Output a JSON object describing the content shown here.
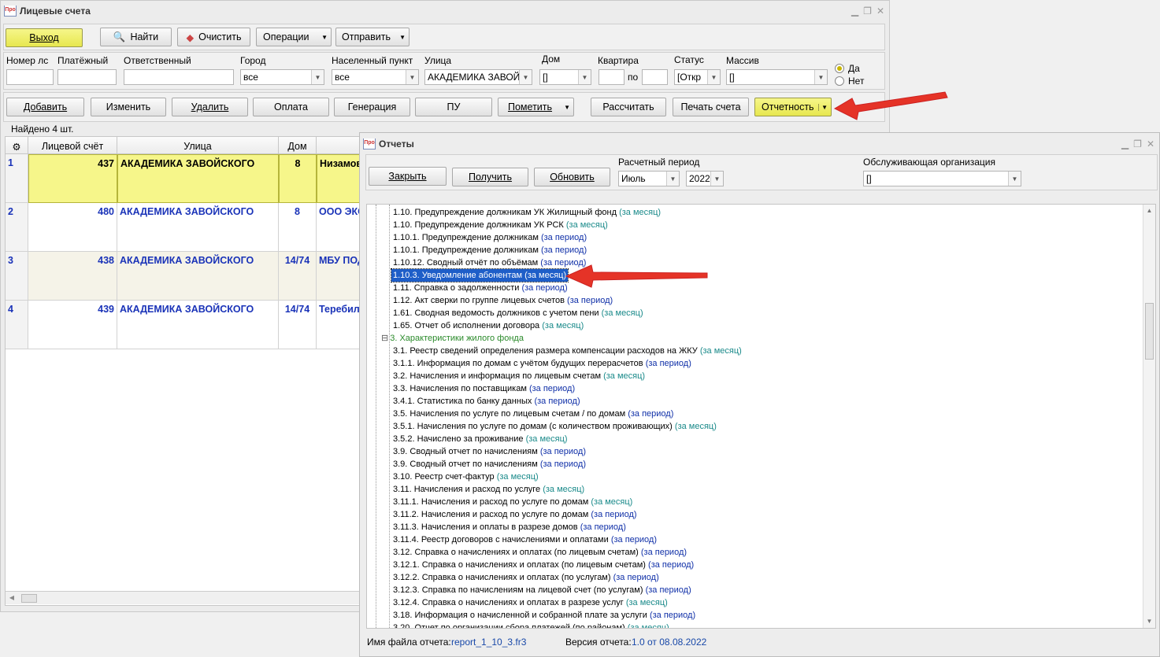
{
  "main": {
    "title": "Лицевые счета",
    "toolbar": {
      "exit": "Выход",
      "find": "Найти",
      "clear": "Очистить",
      "operations": "Операции",
      "send": "Отправить"
    },
    "filters": {
      "account_label": "Номер лс",
      "payer_label": "Платёжный",
      "responsible_label": "Ответственный",
      "city_label": "Город",
      "city_value": "все",
      "locality_label": "Населенный пункт",
      "locality_value": "все",
      "street_label": "Улица",
      "street_value": "АКАДЕМИКА ЗАВОЙСКОГО",
      "house_label": "Дом",
      "house_value": "[]",
      "apartment_label": "Квартира",
      "apartment_to": "по",
      "status_label": "Статус",
      "status_value": "[Откр",
      "array_label": "Массив",
      "array_value": "[]",
      "yes": "Да",
      "no": "Нет"
    },
    "actions": {
      "add": "Добавить",
      "edit": "Изменить",
      "delete": "Удалить",
      "payment": "Оплата",
      "generation": "Генерация",
      "pu": "ПУ",
      "mark": "Пометить",
      "calculate": "Рассчитать",
      "print": "Печать счета",
      "reports": "Отчетность"
    },
    "found": "Найдено 4 шт.",
    "columns": {
      "account": "Лицевой счёт",
      "street": "Улица",
      "house": "Дом"
    },
    "rows": [
      {
        "n": "1",
        "account": "437",
        "street": "АКАДЕМИКА ЗАВОЙСКОГО",
        "house": "8",
        "extra": "Низамов"
      },
      {
        "n": "2",
        "account": "480",
        "street": "АКАДЕМИКА ЗАВОЙСКОГО",
        "house": "8",
        "extra": "ООО ЭКО"
      },
      {
        "n": "3",
        "account": "438",
        "street": "АКАДЕМИКА ЗАВОЙСКОГО",
        "house": "14/74",
        "extra": "МБУ ПОД"
      },
      {
        "n": "4",
        "account": "439",
        "street": "АКАДЕМИКА ЗАВОЙСКОГО",
        "house": "14/74",
        "extra": "Теребил"
      }
    ]
  },
  "reports": {
    "title": "Отчеты",
    "close": "Закрыть",
    "get": "Получить",
    "refresh": "Обновить",
    "period_label": "Расчетный период",
    "month": "Июль",
    "year": "2022",
    "org_label": "Обслуживающая организация",
    "org_value": "[]",
    "tree": [
      {
        "t": "1.10. Предупреждение должникам УК Жилищный фонд",
        "p": "(за месяц)",
        "k": "mon"
      },
      {
        "t": "1.10. Предупреждение должникам УК РСК",
        "p": "(за месяц)",
        "k": "mon"
      },
      {
        "t": "1.10.1. Предупреждение должникам",
        "p": "(за период)",
        "k": "per"
      },
      {
        "t": "1.10.1. Предупреждение должникам",
        "p": "(за период)",
        "k": "per"
      },
      {
        "t": "1.10.12. Сводный отчёт по объёмам",
        "p": "(за период)",
        "k": "per"
      },
      {
        "t": "1.10.3. Уведомление абонентам",
        "p": "(за месяц)",
        "k": "mon",
        "sel": true
      },
      {
        "t": "1.11. Справка о задолженности",
        "p": "(за период)",
        "k": "per"
      },
      {
        "t": "1.12. Акт сверки по группе лицевых счетов",
        "p": "(за период)",
        "k": "per"
      },
      {
        "t": "1.61. Сводная ведомость должников с учетом пени",
        "p": "(за месяц)",
        "k": "mon"
      },
      {
        "t": "1.65. Отчет об исполнении договора",
        "p": "(за месяц)",
        "k": "mon"
      },
      {
        "t": "3. Характеристики жилого фонда",
        "p": "",
        "k": "grp"
      },
      {
        "t": "3.1. Реестр сведений определения размера компенсации расходов на ЖКУ",
        "p": "(за месяц)",
        "k": "mon"
      },
      {
        "t": "3.1.1. Информация по домам с учётом будущих перерасчетов",
        "p": "(за период)",
        "k": "per"
      },
      {
        "t": "3.2. Начисления и информация по лицевым счетам",
        "p": "(за месяц)",
        "k": "mon"
      },
      {
        "t": "3.3. Начисления по поставщикам",
        "p": "(за период)",
        "k": "per"
      },
      {
        "t": "3.4.1. Статистика по банку данных",
        "p": "(за период)",
        "k": "per"
      },
      {
        "t": "3.5. Начисления по услуге по лицевым счетам / по домам",
        "p": "(за период)",
        "k": "per"
      },
      {
        "t": "3.5.1. Начисления по услуге по домам (с количеством проживающих)",
        "p": "(за месяц)",
        "k": "mon"
      },
      {
        "t": "3.5.2. Начислено за проживание",
        "p": "(за месяц)",
        "k": "mon"
      },
      {
        "t": "3.9. Сводный отчет по начислениям",
        "p": "(за период)",
        "k": "per"
      },
      {
        "t": "3.9. Сводный отчет по начислениям",
        "p": "(за период)",
        "k": "per"
      },
      {
        "t": "3.10. Реестр счет-фактур",
        "p": "(за месяц)",
        "k": "mon"
      },
      {
        "t": "3.11. Начисления и расход по услуге",
        "p": "(за месяц)",
        "k": "mon"
      },
      {
        "t": "3.11.1. Начисления и расход по услуге по домам",
        "p": "(за месяц)",
        "k": "mon"
      },
      {
        "t": "3.11.2. Начисления и расход по услуге по домам",
        "p": "(за период)",
        "k": "per"
      },
      {
        "t": "3.11.3. Начисления и оплаты в разрезе домов",
        "p": "(за период)",
        "k": "per"
      },
      {
        "t": "3.11.4. Реестр договоров с начислениями и оплатами",
        "p": "(за период)",
        "k": "per"
      },
      {
        "t": "3.12. Справка о начислениях и оплатах (по лицевым счетам)",
        "p": "(за период)",
        "k": "per"
      },
      {
        "t": "3.12.1. Справка о начислениях и оплатах (по лицевым счетам)",
        "p": "(за период)",
        "k": "per"
      },
      {
        "t": "3.12.2. Справка о начислениях и оплатах (по услугам)",
        "p": "(за период)",
        "k": "per"
      },
      {
        "t": "3.12.3. Справка по начислениям на лицевой счет (по услугам)",
        "p": "(за период)",
        "k": "per"
      },
      {
        "t": "3.12.4. Справка о начислениях и оплатах в разрезе услуг",
        "p": "(за месяц)",
        "k": "mon"
      },
      {
        "t": "3.18. Информация о начисленной и собранной плате за услуги",
        "p": "(за период)",
        "k": "per"
      },
      {
        "t": "3.20. Отчет по организации сбора платежей (по районам)",
        "p": "(за месяц)",
        "k": "mon"
      }
    ],
    "file_label": "Имя файла отчета:",
    "file_value": "report_1_10_3.fr3",
    "version_label": "Версия отчета:",
    "version_value": "1.0 от 08.08.2022"
  }
}
